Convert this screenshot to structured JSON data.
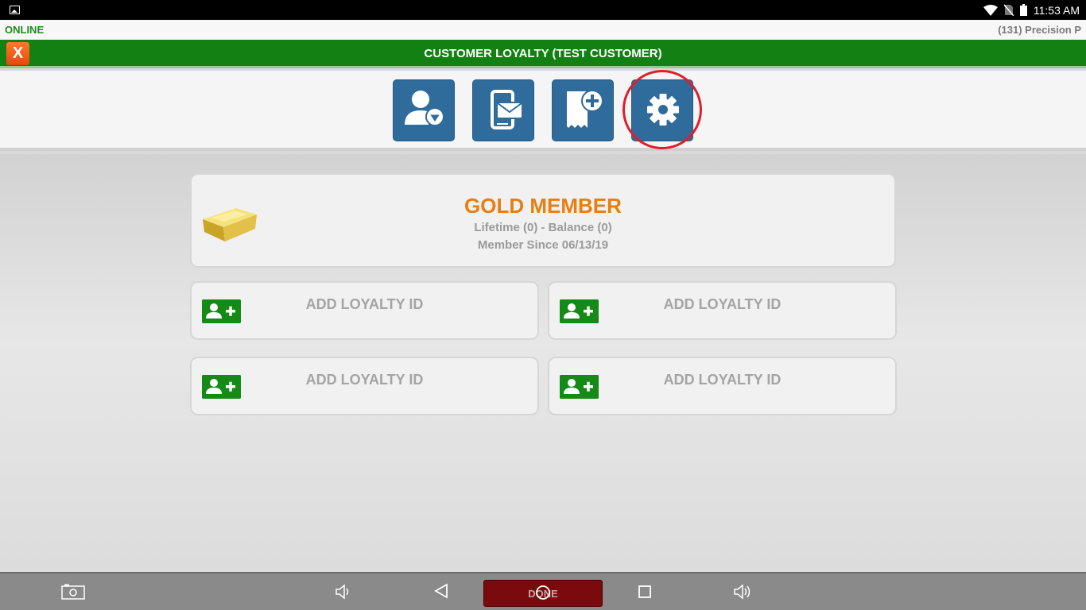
{
  "status_bar": {
    "time": "11:53 AM"
  },
  "subheader": {
    "connection_status": "ONLINE",
    "store_label": "(131) Precision P"
  },
  "titlebar": {
    "close_label": "X",
    "title": "CUSTOMER LOYALTY (TEST CUSTOMER)"
  },
  "toolbar": {
    "tools": [
      {
        "icon": "member-diamond-icon"
      },
      {
        "icon": "phone-message-icon"
      },
      {
        "icon": "add-receipt-icon"
      },
      {
        "icon": "gear-icon"
      }
    ]
  },
  "member": {
    "tier": "GOLD MEMBER",
    "stats": "Lifetime (0) - Balance (0)",
    "since": "Member Since 06/13/19"
  },
  "loyalty_ids": [
    {
      "label": "ADD LOYALTY ID"
    },
    {
      "label": "ADD LOYALTY ID"
    },
    {
      "label": "ADD LOYALTY ID"
    },
    {
      "label": "ADD LOYALTY ID"
    }
  ],
  "navbar": {
    "done_label": "DONE"
  },
  "colors": {
    "accent_green": "#128012",
    "tool_blue": "#2f6c9b",
    "gold_text": "#e67e13",
    "close_orange": "#e4480f",
    "done_red": "#7a0a0e"
  }
}
